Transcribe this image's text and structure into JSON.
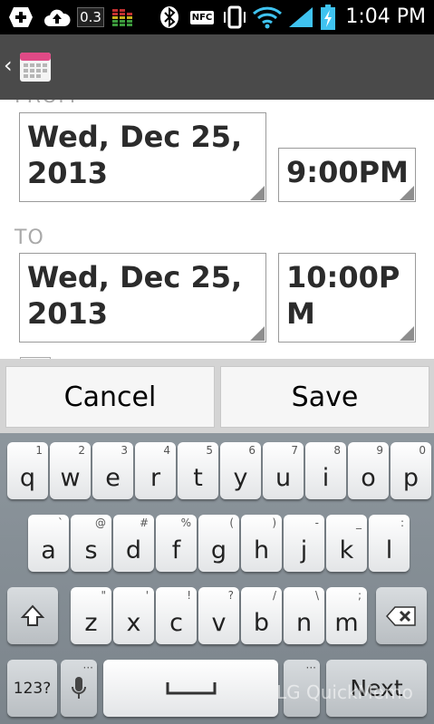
{
  "status_bar": {
    "network_speed": "0.3",
    "nfc_label": "NFC",
    "time": "1:04 PM"
  },
  "form": {
    "from_label": "FROM",
    "from_date": "Wed, Dec 25, 2013",
    "from_time": "9:00PM",
    "to_label": "TO",
    "to_date": "Wed, Dec 25, 2013",
    "to_time": "10:00PM"
  },
  "buttons": {
    "cancel": "Cancel",
    "save": "Save"
  },
  "keyboard": {
    "row1": [
      {
        "key": "q",
        "sec": "1"
      },
      {
        "key": "w",
        "sec": "2"
      },
      {
        "key": "e",
        "sec": "3"
      },
      {
        "key": "r",
        "sec": "4"
      },
      {
        "key": "t",
        "sec": "5"
      },
      {
        "key": "y",
        "sec": "6"
      },
      {
        "key": "u",
        "sec": "7"
      },
      {
        "key": "i",
        "sec": "8"
      },
      {
        "key": "o",
        "sec": "9"
      },
      {
        "key": "p",
        "sec": "0"
      }
    ],
    "row2": [
      {
        "key": "a",
        "sec": "`"
      },
      {
        "key": "s",
        "sec": "@"
      },
      {
        "key": "d",
        "sec": "#"
      },
      {
        "key": "f",
        "sec": "%"
      },
      {
        "key": "g",
        "sec": "("
      },
      {
        "key": "h",
        "sec": ")"
      },
      {
        "key": "j",
        "sec": "-"
      },
      {
        "key": "k",
        "sec": "_"
      },
      {
        "key": "l",
        "sec": ":"
      }
    ],
    "row3": [
      {
        "key": "z",
        "sec": "\""
      },
      {
        "key": "x",
        "sec": "'"
      },
      {
        "key": "c",
        "sec": "!"
      },
      {
        "key": "v",
        "sec": "?"
      },
      {
        "key": "b",
        "sec": "/"
      },
      {
        "key": "n",
        "sec": "\\"
      },
      {
        "key": "m",
        "sec": ";"
      }
    ],
    "mode_label": "123?",
    "next_label": "Next"
  },
  "watermark": "LG QuickMemo",
  "colors": {
    "action_bar": "#4a4a4a",
    "battery": "#3fc3f0",
    "wifi": "#3fc3f0",
    "label_gray": "#a9a9a9"
  },
  "icons": [
    "add-icon",
    "upload-icon",
    "equalizer-icon",
    "bluetooth-icon",
    "nfc-icon",
    "vibrate-icon",
    "wifi-icon",
    "signal-icon",
    "battery-charging-icon",
    "calendar-icon",
    "shift-icon",
    "backspace-icon",
    "mic-icon",
    "space-icon"
  ]
}
